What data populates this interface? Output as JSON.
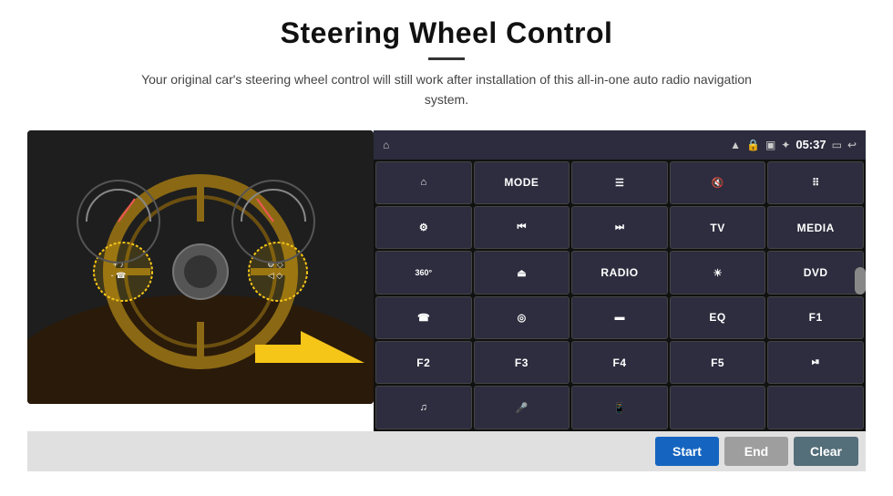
{
  "header": {
    "title": "Steering Wheel Control",
    "subtitle": "Your original car's steering wheel control will still work after installation of this all-in-one auto radio navigation system."
  },
  "status_bar": {
    "time": "05:37",
    "icons": [
      "wifi",
      "lock",
      "sim",
      "bluetooth",
      "battery",
      "screen",
      "back"
    ]
  },
  "grid_buttons": [
    {
      "id": "r0c0",
      "icon": "nav",
      "symbol": "⌂",
      "type": "icon"
    },
    {
      "id": "r0c1",
      "label": "MODE",
      "type": "text"
    },
    {
      "id": "r0c2",
      "icon": "menu",
      "symbol": "☰",
      "type": "icon"
    },
    {
      "id": "r0c3",
      "icon": "mute",
      "symbol": "🔇",
      "type": "icon"
    },
    {
      "id": "r0c4",
      "icon": "apps",
      "symbol": "⠿",
      "type": "icon"
    },
    {
      "id": "r1c0",
      "icon": "settings",
      "symbol": "⚙",
      "type": "icon"
    },
    {
      "id": "r1c1",
      "icon": "prev",
      "symbol": "⏮",
      "type": "icon"
    },
    {
      "id": "r1c2",
      "icon": "next",
      "symbol": "⏭",
      "type": "icon"
    },
    {
      "id": "r1c3",
      "label": "TV",
      "type": "text"
    },
    {
      "id": "r1c4",
      "label": "MEDIA",
      "type": "text"
    },
    {
      "id": "r2c0",
      "icon": "360cam",
      "symbol": "360°",
      "type": "icon"
    },
    {
      "id": "r2c1",
      "icon": "eject",
      "symbol": "⏏",
      "type": "icon"
    },
    {
      "id": "r2c2",
      "label": "RADIO",
      "type": "text"
    },
    {
      "id": "r2c3",
      "icon": "brightness",
      "symbol": "☀",
      "type": "icon"
    },
    {
      "id": "r2c4",
      "label": "DVD",
      "type": "text"
    },
    {
      "id": "r3c0",
      "icon": "phone",
      "symbol": "📞",
      "type": "icon"
    },
    {
      "id": "r3c1",
      "icon": "browse",
      "symbol": "◎",
      "type": "icon"
    },
    {
      "id": "r3c2",
      "icon": "screen",
      "symbol": "▬",
      "type": "icon"
    },
    {
      "id": "r3c3",
      "label": "EQ",
      "type": "text"
    },
    {
      "id": "r3c4",
      "label": "F1",
      "type": "text"
    },
    {
      "id": "r4c0",
      "label": "F2",
      "type": "text"
    },
    {
      "id": "r4c1",
      "label": "F3",
      "type": "text"
    },
    {
      "id": "r4c2",
      "label": "F4",
      "type": "text"
    },
    {
      "id": "r4c3",
      "label": "F5",
      "type": "text"
    },
    {
      "id": "r4c4",
      "icon": "playpause",
      "symbol": "⏯",
      "type": "icon"
    },
    {
      "id": "r5c0",
      "icon": "music",
      "symbol": "♫",
      "type": "icon"
    },
    {
      "id": "r5c1",
      "icon": "mic",
      "symbol": "🎤",
      "type": "icon"
    },
    {
      "id": "r5c2",
      "icon": "call",
      "symbol": "📱",
      "type": "icon"
    },
    {
      "id": "r5c3",
      "label": "",
      "type": "empty"
    },
    {
      "id": "r5c4",
      "label": "",
      "type": "empty"
    }
  ],
  "bottom_bar": {
    "start_label": "Start",
    "end_label": "End",
    "clear_label": "Clear"
  }
}
